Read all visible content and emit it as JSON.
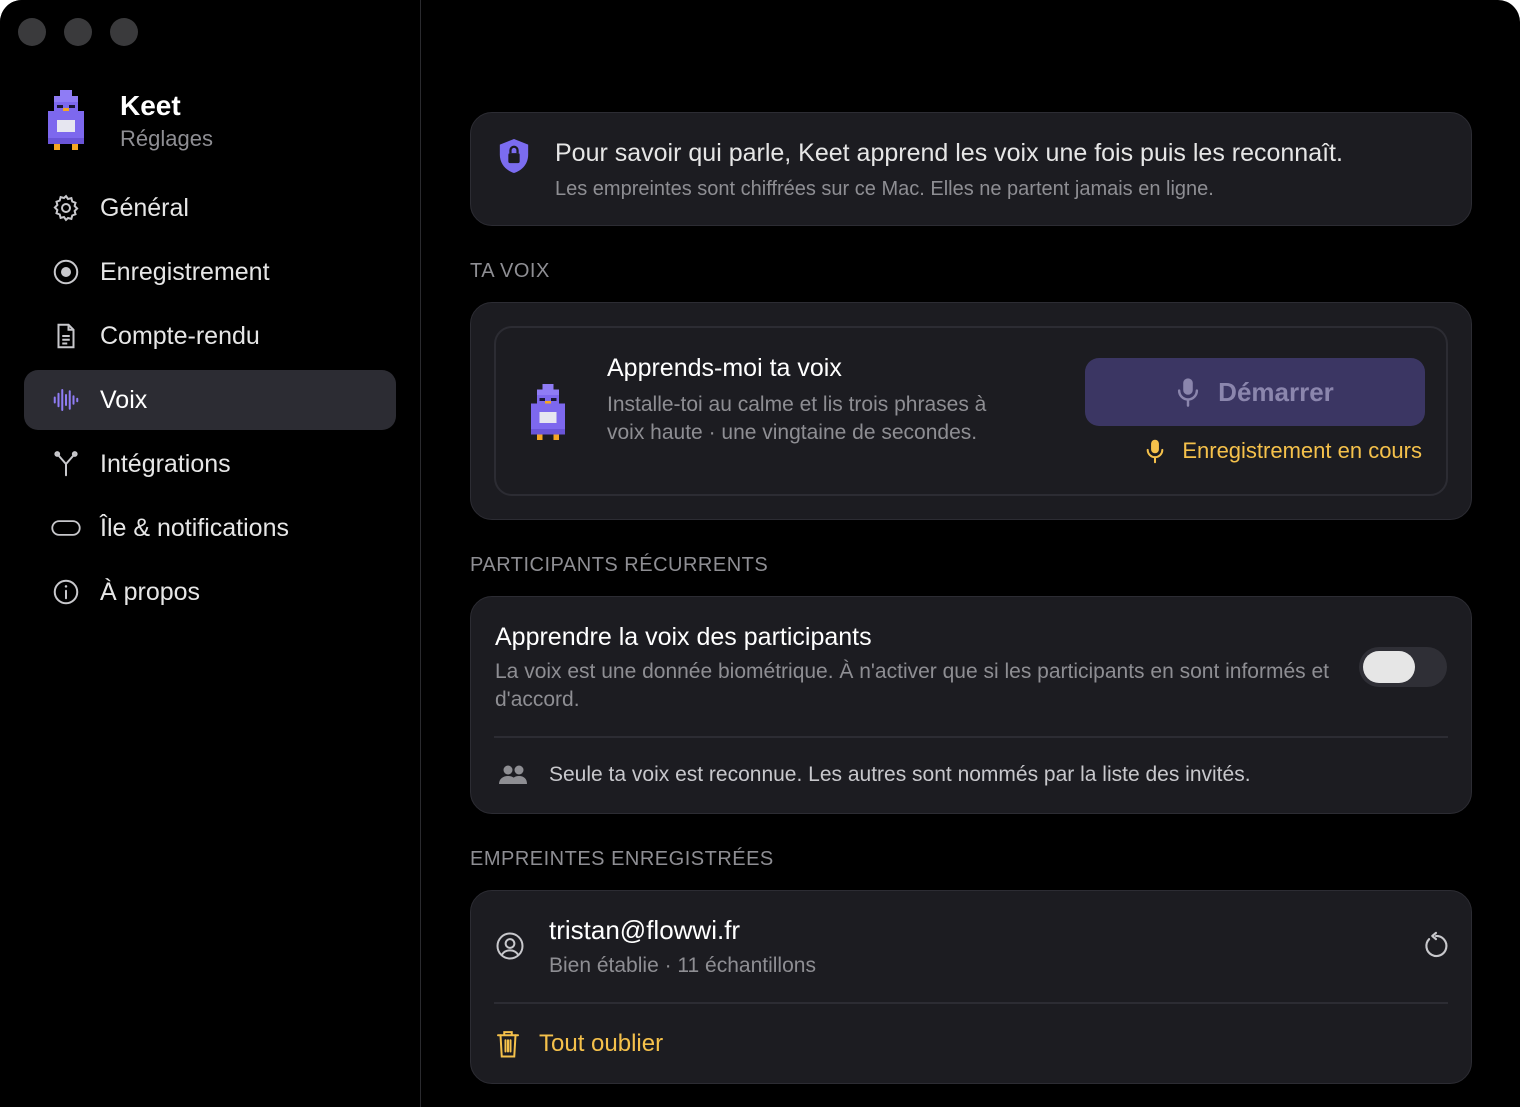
{
  "app": {
    "name": "Keet",
    "subtitle": "Réglages"
  },
  "sidebar": {
    "items": [
      {
        "label": "Général",
        "icon": "gear-icon"
      },
      {
        "label": "Enregistrement",
        "icon": "record-icon"
      },
      {
        "label": "Compte-rendu",
        "icon": "document-icon"
      },
      {
        "label": "Voix",
        "icon": "waveform-icon",
        "active": true
      },
      {
        "label": "Intégrations",
        "icon": "integrations-icon"
      },
      {
        "label": "Île & notifications",
        "icon": "island-icon"
      },
      {
        "label": "À propos",
        "icon": "info-icon"
      }
    ]
  },
  "info_banner": {
    "title": "Pour savoir qui parle, Keet apprend les voix une fois puis les reconnaît.",
    "subtitle": "Les empreintes sont chiffrées sur ce Mac. Elles ne partent jamais en ligne."
  },
  "voice_section": {
    "label": "TA VOIX",
    "title": "Apprends-moi ta voix",
    "description": "Installe-toi au calme et lis trois phrases à voix haute · une vingtaine de secondes.",
    "start_button": "Démarrer",
    "recording_status": "Enregistrement en cours"
  },
  "participants_section": {
    "label": "PARTICIPANTS RÉCURRENTS",
    "title": "Apprendre la voix des participants",
    "description": "La voix est une donnée biométrique. À n'activer que si les participants en sont informés et d'accord.",
    "toggle_on": false,
    "note": "Seule ta voix est reconnue. Les autres sont nommés par la liste des invités."
  },
  "prints_section": {
    "label": "EMPREINTES ENREGISTRÉES",
    "entries": [
      {
        "email": "tristan@flowwi.fr",
        "detail": "Bien établie · 11 échantillons"
      }
    ],
    "forget_all": "Tout oublier"
  },
  "colors": {
    "accent": "#7b6cf0",
    "warning": "#f5c14b",
    "button_bg": "#3b3663"
  }
}
